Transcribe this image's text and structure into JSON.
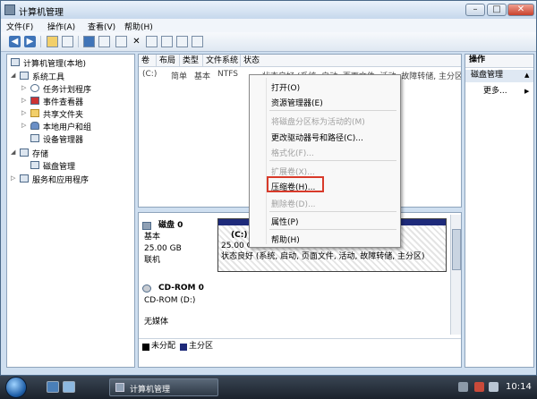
{
  "window": {
    "title": "计算机管理",
    "controls": {
      "minimize": "–",
      "maximize": "□",
      "close": "✕"
    }
  },
  "menu": [
    "文件(F)",
    "操作(A)",
    "查看(V)",
    "帮助(H)"
  ],
  "toolbar": {
    "delete_glyph": "✕",
    "arrow_left": "◀",
    "arrow_right": "▶"
  },
  "tree": {
    "root": "计算机管理(本地)",
    "system_tools": "系统工具",
    "task_scheduler": "任务计划程序",
    "event_viewer": "事件查看器",
    "shared_folders": "共享文件夹",
    "local_users": "本地用户和组",
    "device_manager": "设备管理器",
    "storage": "存储",
    "disk_management": "磁盘管理",
    "services": "服务和应用程序"
  },
  "table": {
    "headers": [
      "卷",
      "布局",
      "类型",
      "文件系统",
      "状态"
    ],
    "row": {
      "volume": "(C:)",
      "layout": "简单",
      "type": "基本",
      "fs": "NTFS",
      "status": "状态良好 (系统, 启动, 页面文件, 活动, 故障转储, 主分区)"
    }
  },
  "disk0": {
    "name": "磁盘 0",
    "type": "基本",
    "size": "25.00 GB",
    "state": "联机",
    "part_name": "(C:)",
    "part_size": "25.00 GB NTFS",
    "part_status": "状态良好 (系统, 启动, 页面文件, 活动, 故障转储, 主分区)"
  },
  "cdrom": {
    "name": "CD-ROM 0",
    "drive": "CD-ROM (D:)",
    "media": "无媒体"
  },
  "legend": {
    "unallocated": "未分配",
    "primary": "主分区"
  },
  "actions": {
    "header": "操作",
    "section": "磁盘管理",
    "more": "更多...",
    "arrow_up": "▲",
    "arrow_right": "▶"
  },
  "context_menu": {
    "open": "打开(O)",
    "explorer": "资源管理器(E)",
    "mark_active": "将磁盘分区标为活动的(M)",
    "change_letter": "更改驱动器号和路径(C)...",
    "format": "格式化(F)...",
    "extend": "扩展卷(X)...",
    "shrink": "压缩卷(H)...",
    "delete": "删除卷(D)...",
    "properties": "属性(P)",
    "help": "帮助(H)"
  },
  "taskbar": {
    "task": "计算机管理",
    "clock": "10:14"
  },
  "colors": {
    "primary_partition": "#1e2a7a",
    "unallocated": "#000000",
    "highlight": "#d83a2a"
  }
}
